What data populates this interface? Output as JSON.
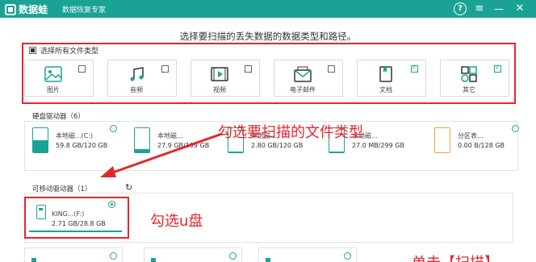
{
  "app": {
    "logo_text": "数据蛙",
    "subtitle": "数据恢复专家"
  },
  "window_controls": {
    "help": "?",
    "menu": "≡",
    "minimize": "—",
    "close": "✕"
  },
  "headline": "选择要扫描的丢失数据的数据类型和路径。",
  "file_types": {
    "select_all_label": "选择所有文件类型",
    "items": [
      {
        "label": "图片",
        "icon": "image-icon",
        "checked": false
      },
      {
        "label": "音频",
        "icon": "music-icon",
        "checked": false
      },
      {
        "label": "视频",
        "icon": "video-icon",
        "checked": false
      },
      {
        "label": "电子邮件",
        "icon": "email-icon",
        "checked": false
      },
      {
        "label": "文档",
        "icon": "document-icon",
        "checked": true
      },
      {
        "label": "其它",
        "icon": "other-icon",
        "checked": true
      }
    ]
  },
  "hard_drives": {
    "label": "硬盘驱动器（6）",
    "items": [
      {
        "name": "本地磁...(C:)",
        "size": "59.8 GB/120 GB",
        "used_fraction": 0.5,
        "color": "#1aa394"
      },
      {
        "name": "本地磁...",
        "size": "27.9 GB/199 GB",
        "used_fraction": 0.14,
        "color": "#1aa394"
      },
      {
        "name": "本地磁...",
        "size": "2.80 GB/120 GB",
        "used_fraction": 0.05,
        "color": "#1aa394"
      },
      {
        "name": "本地磁...",
        "size": "27.0 MB/299 GB",
        "used_fraction": 0.0,
        "color": "#1aa394"
      },
      {
        "name": "分区表...",
        "size": "0.00 B/128 GB",
        "used_fraction": 0.0,
        "color": "#f0a040"
      }
    ]
  },
  "removable_drives": {
    "label": "可移动驱动器（1）",
    "refresh_icon": "refresh-icon",
    "items": [
      {
        "name": "KING...(F:)",
        "size": "2.71 GB/28.8 GB",
        "selected": true
      }
    ]
  },
  "annotations": {
    "file_type_hint": "勾选要扫描的文件类型",
    "usb_hint": "勾选u盘",
    "scan_hint": "单击【扫描】"
  },
  "colors": {
    "brand": "#1aa394",
    "highlight_red": "#e4262c"
  }
}
